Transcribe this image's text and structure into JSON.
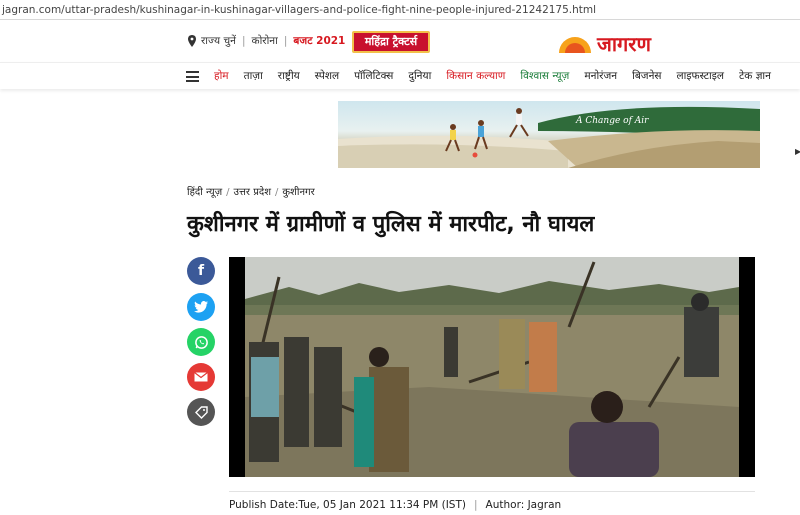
{
  "browser": {
    "url": "jagran.com/uttar-pradesh/kushinagar-in-kushinagar-villagers-and-police-fight-nine-people-injured-21242175.html"
  },
  "topbar": {
    "state_select": "राज्य चुनें",
    "corona": "कोरोना",
    "budget": "बजट 2021",
    "sponsor": "महिंद्रा ट्रैक्टर्स",
    "logo_text": "जागरण"
  },
  "nav": {
    "items": [
      "होम",
      "ताज़ा",
      "राष्ट्रीय",
      "स्पेशल",
      "पॉलिटिक्स",
      "दुनिया",
      "किसान कल्याण",
      "विश्वास न्यूज़",
      "मनोरंजन",
      "बिजनेस",
      "लाइफस्टाइल",
      "टेक ज्ञान"
    ]
  },
  "ad": {
    "caption": "A Change of Air"
  },
  "breadcrumb": [
    "हिंदी न्यूज़",
    "उत्तर प्रदेश",
    "कुशीनगर"
  ],
  "article": {
    "title": "कुशीनगर में ग्रामीणों व पुलिस में मारपीट, नौ घायल",
    "publish": "Publish Date:Tue, 05 Jan 2021 11:34 PM (IST)",
    "author": "Author: Jagran"
  },
  "colors": {
    "brand_red": "#d71920",
    "facebook": "#3b5998",
    "twitter": "#1da1f2",
    "whatsapp": "#25d366",
    "mail": "#e53935"
  }
}
